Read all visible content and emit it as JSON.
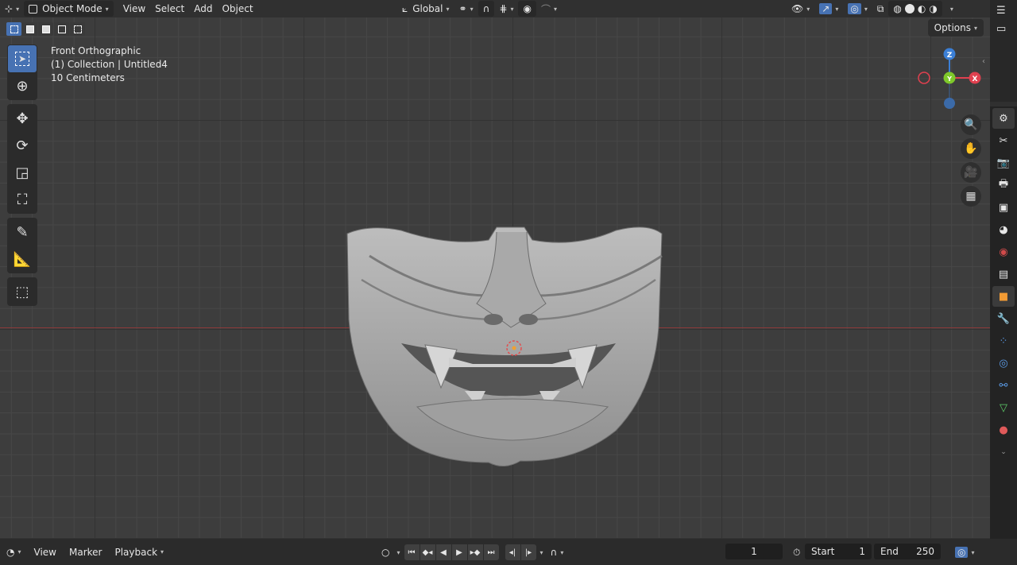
{
  "header": {
    "editor_type_icon": "axis-icon",
    "mode": "Object Mode",
    "menus": [
      "View",
      "Select",
      "Add",
      "Object"
    ],
    "transform_orientation": "Global"
  },
  "viewport": {
    "view_name": "Front Orthographic",
    "collection": "(1) Collection | Untitled4",
    "scale": "10 Centimeters",
    "options_label": "Options"
  },
  "gizmo": {
    "z": "Z",
    "y": "Y",
    "x": "X"
  },
  "timeline": {
    "menus": [
      "View",
      "Marker",
      "Playback"
    ],
    "current_frame": "1",
    "start_label": "Start",
    "start_value": "1",
    "end_label": "End",
    "end_value": "250"
  },
  "colors": {
    "accent": "#4772b3",
    "x_axis": "#e0404f",
    "y_axis": "#7ec82a",
    "z_axis": "#3b7fd6"
  }
}
